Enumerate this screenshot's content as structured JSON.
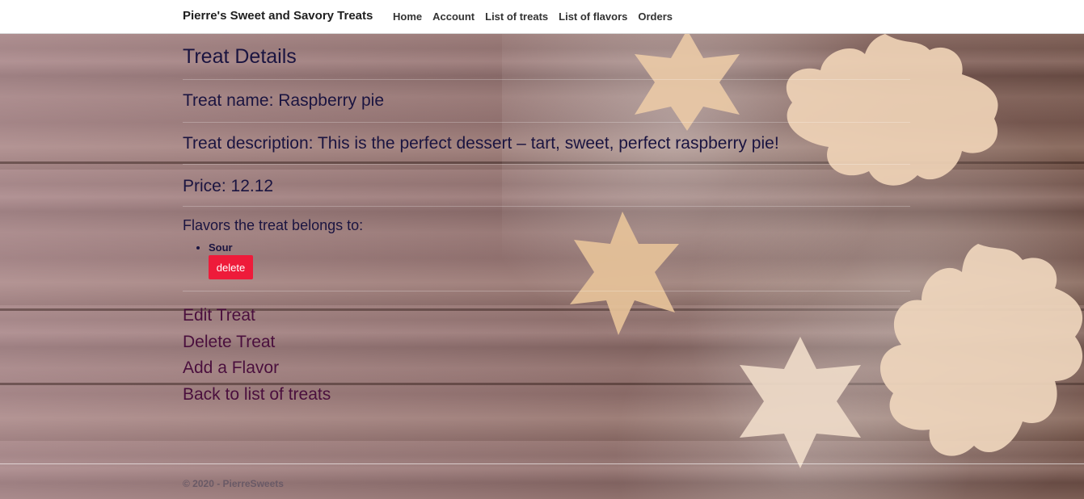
{
  "navbar": {
    "brand": "Pierre's Sweet and Savory Treats",
    "links": [
      "Home",
      "Account",
      "List of treats",
      "List of flavors",
      "Orders"
    ]
  },
  "main": {
    "title": "Treat Details",
    "treat_name": "Treat name: Raspberry pie",
    "treat_description": "Treat description: This is the perfect dessert – tart, sweet, perfect raspberry pie!",
    "price": "Price: 12.12",
    "flavors_heading": "Flavors the treat belongs to:",
    "flavors": [
      {
        "name": "Sour",
        "delete_label": "delete"
      }
    ],
    "actions": [
      "Edit Treat",
      "Delete Treat",
      "Add a Flavor",
      "Back to list of treats"
    ]
  },
  "footer": {
    "text": "© 2020 - PierreSweets"
  },
  "colors": {
    "delete_button": "#ee1b3a",
    "heading_text": "#1a1440",
    "link_text": "#4a0f3d"
  }
}
